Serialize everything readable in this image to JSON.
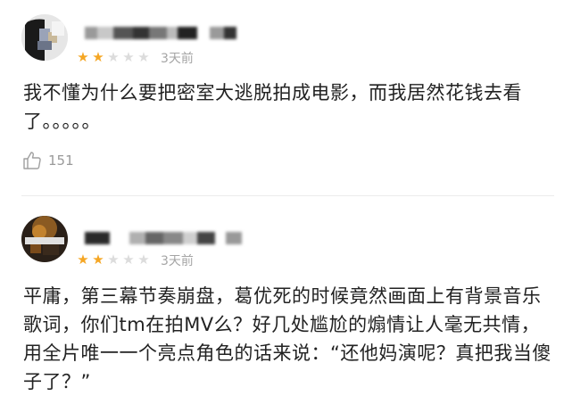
{
  "colors": {
    "star_filled": "#f5a623",
    "star_empty": "#dcdcdc",
    "meta_text": "#a5a5a5",
    "body_text": "#222222"
  },
  "reviews": [
    {
      "rating": 2,
      "rating_max": 5,
      "time": "3天前",
      "content": "我不懂为什么要把密室大逃脱拍成电影，而我居然花钱去看了。。。。。",
      "likes": "151",
      "like_icon": "thumbs-up-icon"
    },
    {
      "rating": 2,
      "rating_max": 5,
      "time": "3天前",
      "content": "平庸，第三幕节奏崩盘，葛优死的时候竟然画面上有背景音乐歌词，你们tm在拍MV么？好几处尴尬的煽情让人毫无共情，用全片唯一一个亮点角色的话来说：“还他妈演呢？真把我当傻子了？”"
    }
  ]
}
